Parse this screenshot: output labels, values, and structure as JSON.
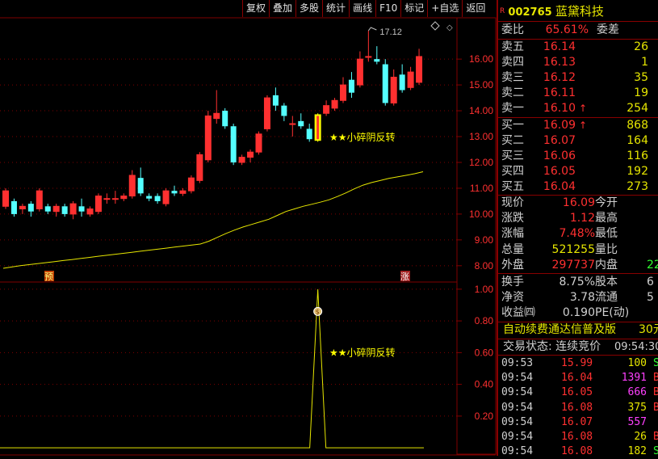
{
  "toolbar": [
    "复权",
    "叠加",
    "多股",
    "统计",
    "画线",
    "F10",
    "标记",
    "+自选",
    "返回"
  ],
  "stock": {
    "badge": "R",
    "code": "002765",
    "name": "蓝黛科技"
  },
  "weibi": {
    "label": "委比",
    "value": "65.61%",
    "label2": "委差"
  },
  "asks": [
    {
      "label": "卖五",
      "price": "16.14",
      "vol": "26"
    },
    {
      "label": "卖四",
      "price": "16.13",
      "vol": "1"
    },
    {
      "label": "卖三",
      "price": "16.12",
      "vol": "35"
    },
    {
      "label": "卖二",
      "price": "16.11",
      "vol": "19"
    },
    {
      "label": "卖一",
      "price": "16.10",
      "arrow": "↑",
      "vol": "254"
    }
  ],
  "bids": [
    {
      "label": "买一",
      "price": "16.09",
      "arrow": "↑",
      "vol": "868"
    },
    {
      "label": "买二",
      "price": "16.07",
      "vol": "164"
    },
    {
      "label": "买三",
      "price": "16.06",
      "vol": "116"
    },
    {
      "label": "买四",
      "price": "16.05",
      "vol": "192"
    },
    {
      "label": "买五",
      "price": "16.04",
      "vol": "273"
    }
  ],
  "quote": [
    {
      "label": "现价",
      "value": "16.09",
      "label2": "今开",
      "value2": ""
    },
    {
      "label": "涨跌",
      "value": "1.12",
      "label2": "最高",
      "value2": ""
    },
    {
      "label": "涨幅",
      "value": "7.48%",
      "label2": "最低",
      "value2": ""
    },
    {
      "label": "总量",
      "value": "521255",
      "label2": "量比",
      "value2": ""
    },
    {
      "label": "外盘",
      "value": "297737",
      "label2": "内盘",
      "value2": "22"
    }
  ],
  "fund": [
    {
      "label": "换手",
      "value": "8.75%",
      "label2": "股本",
      "value2": "6"
    },
    {
      "label": "净资",
      "value": "3.78",
      "label2": "流通",
      "value2": "5"
    },
    {
      "label": "收益㈣",
      "value": "0.190",
      "label2": "PE(动)",
      "value2": ""
    }
  ],
  "promo": {
    "text": "自动续费通达信普及版",
    "price": "30元"
  },
  "trade_status": {
    "label": "交易状态: 连续竞价",
    "time": "09:54:30"
  },
  "ticks": [
    {
      "time": "09:53",
      "price": "15.99",
      "vol": "100",
      "flag": "S"
    },
    {
      "time": "09:54",
      "price": "16.04",
      "vol": "1391",
      "flag": "B"
    },
    {
      "time": "09:54",
      "price": "16.05",
      "vol": "666",
      "flag": "B"
    },
    {
      "time": "09:54",
      "price": "16.08",
      "vol": "375",
      "flag": "B"
    },
    {
      "time": "09:54",
      "price": "16.07",
      "vol": "557",
      "flag": ""
    },
    {
      "time": "09:54",
      "price": "16.08",
      "vol": "26",
      "flag": "B"
    },
    {
      "time": "09:54",
      "price": "16.08",
      "vol": "182",
      "flag": "S"
    }
  ],
  "colors": {
    "up": "#ff3030",
    "down": "#54ffff",
    "ma": "#e6e600",
    "grid": "#800000",
    "signal": "#ffff00",
    "purple": "#ff40ff"
  },
  "chart_data": {
    "type": "candlestick",
    "price_axis": {
      "ticks": [
        "16.00",
        "15.00",
        "14.00",
        "13.00",
        "12.00",
        "11.00",
        "10.00",
        "9.00",
        "8.00"
      ],
      "ylim": [
        7.4,
        17.6
      ]
    },
    "indicator_axis": {
      "ticks": [
        "1.00",
        "0.80",
        "0.60",
        "0.40",
        "0.20"
      ],
      "ylim": [
        -0.04,
        1.04
      ]
    },
    "candles": [
      {
        "o": 10.3,
        "c": 10.9,
        "h": 11.0,
        "l": 10.2
      },
      {
        "o": 10.5,
        "c": 10.0,
        "h": 10.6,
        "l": 9.9
      },
      {
        "o": 10.2,
        "c": 10.3,
        "h": 10.4,
        "l": 10.0
      },
      {
        "o": 10.4,
        "c": 10.1,
        "h": 10.5,
        "l": 9.9
      },
      {
        "o": 10.2,
        "c": 10.9,
        "h": 11.0,
        "l": 10.1
      },
      {
        "o": 10.3,
        "c": 10.1,
        "h": 10.4,
        "l": 10.0
      },
      {
        "o": 10.1,
        "c": 10.3,
        "h": 10.4,
        "l": 9.9
      },
      {
        "o": 10.3,
        "c": 10.0,
        "h": 10.4,
        "l": 9.9
      },
      {
        "o": 10.0,
        "c": 10.4,
        "h": 10.5,
        "l": 9.8
      },
      {
        "o": 10.3,
        "c": 10.1,
        "h": 10.6,
        "l": 9.9
      },
      {
        "o": 10.0,
        "c": 10.2,
        "h": 10.3,
        "l": 9.9
      },
      {
        "o": 10.1,
        "c": 10.7,
        "h": 10.8,
        "l": 10.0
      },
      {
        "o": 10.6,
        "c": 10.6,
        "h": 10.8,
        "l": 10.4
      },
      {
        "o": 10.6,
        "c": 10.6,
        "h": 10.9,
        "l": 10.4
      },
      {
        "o": 10.6,
        "c": 10.7,
        "h": 10.8,
        "l": 10.5
      },
      {
        "o": 10.7,
        "c": 11.5,
        "h": 11.7,
        "l": 10.6
      },
      {
        "o": 11.4,
        "c": 10.8,
        "h": 11.8,
        "l": 10.7
      },
      {
        "o": 10.7,
        "c": 10.6,
        "h": 10.8,
        "l": 10.5
      },
      {
        "o": 10.7,
        "c": 10.5,
        "h": 10.8,
        "l": 10.4
      },
      {
        "o": 10.4,
        "c": 10.9,
        "h": 11.0,
        "l": 10.3
      },
      {
        "o": 10.9,
        "c": 10.8,
        "h": 11.1,
        "l": 10.7
      },
      {
        "o": 10.8,
        "c": 10.9,
        "h": 11.0,
        "l": 10.7
      },
      {
        "o": 10.9,
        "c": 11.4,
        "h": 11.5,
        "l": 10.8
      },
      {
        "o": 11.3,
        "c": 12.3,
        "h": 12.4,
        "l": 11.2
      },
      {
        "o": 12.1,
        "c": 13.8,
        "h": 14.0,
        "l": 12.0
      },
      {
        "o": 13.7,
        "c": 13.9,
        "h": 14.8,
        "l": 13.5
      },
      {
        "o": 14.0,
        "c": 13.4,
        "h": 14.1,
        "l": 13.3
      },
      {
        "o": 13.4,
        "c": 12.0,
        "h": 13.5,
        "l": 11.9
      },
      {
        "o": 12.0,
        "c": 12.2,
        "h": 12.3,
        "l": 11.9
      },
      {
        "o": 12.2,
        "c": 12.4,
        "h": 12.5,
        "l": 12.0
      },
      {
        "o": 12.4,
        "c": 13.1,
        "h": 13.2,
        "l": 12.3
      },
      {
        "o": 13.3,
        "c": 14.5,
        "h": 14.6,
        "l": 13.2
      },
      {
        "o": 14.6,
        "c": 14.2,
        "h": 14.9,
        "l": 14.0
      },
      {
        "o": 14.2,
        "c": 13.8,
        "h": 14.3,
        "l": 13.6
      },
      {
        "o": 13.5,
        "c": 13.5,
        "h": 13.8,
        "l": 13.0
      },
      {
        "o": 13.6,
        "c": 13.4,
        "h": 13.9,
        "l": 13.3
      },
      {
        "o": 13.3,
        "c": 12.9,
        "h": 13.5,
        "l": 12.8
      },
      {
        "o": 12.9,
        "c": 13.8,
        "h": 13.9,
        "l": 12.8
      },
      {
        "o": 13.9,
        "c": 14.2,
        "h": 14.4,
        "l": 13.8
      },
      {
        "o": 14.1,
        "c": 14.4,
        "h": 14.5,
        "l": 14.0
      },
      {
        "o": 14.4,
        "c": 15.0,
        "h": 15.3,
        "l": 14.3
      },
      {
        "o": 15.2,
        "c": 14.7,
        "h": 15.5,
        "l": 14.5
      },
      {
        "o": 15.0,
        "c": 16.0,
        "h": 16.3,
        "l": 14.9
      },
      {
        "o": 16.1,
        "c": 16.1,
        "h": 17.1,
        "l": 15.9
      },
      {
        "o": 16.0,
        "c": 15.9,
        "h": 16.5,
        "l": 15.8
      },
      {
        "o": 15.8,
        "c": 14.3,
        "h": 16.0,
        "l": 14.2
      },
      {
        "o": 14.3,
        "c": 15.3,
        "h": 15.6,
        "l": 14.2
      },
      {
        "o": 15.4,
        "c": 14.8,
        "h": 15.8,
        "l": 14.7
      },
      {
        "o": 14.9,
        "c": 15.5,
        "h": 15.7,
        "l": 14.8
      },
      {
        "o": 15.1,
        "c": 16.1,
        "h": 16.4,
        "l": 15.0
      }
    ],
    "ma": [
      7.9,
      7.95,
      8.0,
      8.04,
      8.08,
      8.12,
      8.16,
      8.2,
      8.24,
      8.28,
      8.32,
      8.36,
      8.4,
      8.44,
      8.48,
      8.52,
      8.56,
      8.6,
      8.64,
      8.68,
      8.72,
      8.76,
      8.8,
      8.84,
      8.95,
      9.1,
      9.25,
      9.38,
      9.5,
      9.6,
      9.7,
      9.8,
      9.95,
      10.1,
      10.2,
      10.3,
      10.38,
      10.46,
      10.55,
      10.68,
      10.82,
      10.98,
      11.12,
      11.22,
      11.3,
      11.38,
      11.44,
      11.5,
      11.56,
      11.64
    ],
    "highlight_index": 37,
    "high_label": "17.12",
    "signal_label": "★★小碎阴反转",
    "markers": {
      "left": "预",
      "right": "涨"
    },
    "indicator": {
      "values": "0 everywhere except a 1.00 spike at index 37"
    }
  }
}
